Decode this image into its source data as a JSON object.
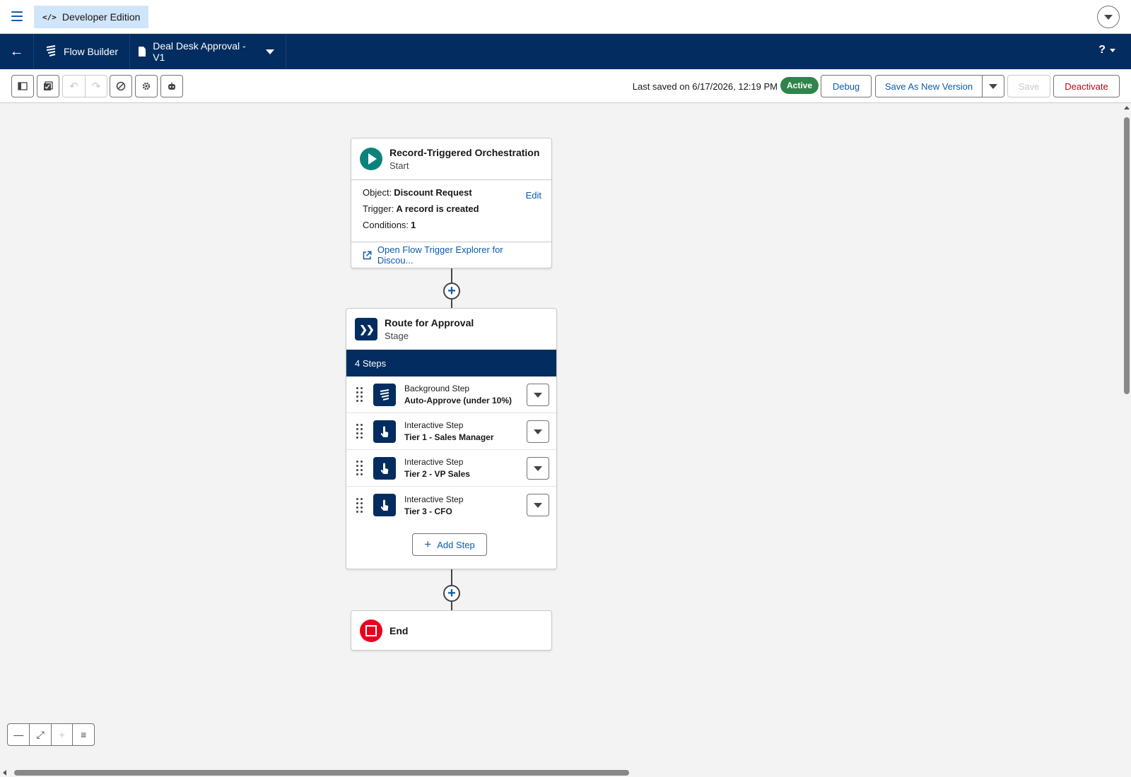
{
  "header": {
    "edition_label": "Developer Edition",
    "edition_icon": "code-icon"
  },
  "nav": {
    "app_name": "Flow Builder",
    "flow_name": "Deal Desk Approval - V1",
    "help_label": "?"
  },
  "toolbar": {
    "last_saved": "Last saved on 6/17/2026, 12:19 PM",
    "status_badge": "Active",
    "debug_label": "Debug",
    "save_new_version_label": "Save As New Version",
    "save_label": "Save",
    "deactivate_label": "Deactivate"
  },
  "start_node": {
    "title": "Record-Triggered Orchestration",
    "subtitle": "Start",
    "object_label": "Object:",
    "object_value": "Discount Request",
    "edit_label": "Edit",
    "trigger_label": "Trigger:",
    "trigger_value": "A record is created",
    "conditions_label": "Conditions:",
    "conditions_value": "1",
    "explorer_link": "Open Flow Trigger Explorer for Discou..."
  },
  "stage_node": {
    "title": "Route for Approval",
    "subtitle": "Stage",
    "steps_count": "4 Steps",
    "steps": [
      {
        "type": "Background Step",
        "name": "Auto-Approve (under 10%)",
        "icon": "flow-icon"
      },
      {
        "type": "Interactive Step",
        "name": "Tier 1 - Sales Manager",
        "icon": "touch-icon"
      },
      {
        "type": "Interactive Step",
        "name": "Tier 2 - VP Sales",
        "icon": "touch-icon"
      },
      {
        "type": "Interactive Step",
        "name": "Tier 3 - CFO",
        "icon": "touch-icon"
      }
    ],
    "add_step_label": "Add Step"
  },
  "end_node": {
    "title": "End"
  },
  "colors": {
    "brand_navy": "#032d60",
    "link_blue": "#0b5cab",
    "active_green": "#2e844a",
    "start_teal": "#0b827c",
    "end_red": "#ea001e"
  }
}
